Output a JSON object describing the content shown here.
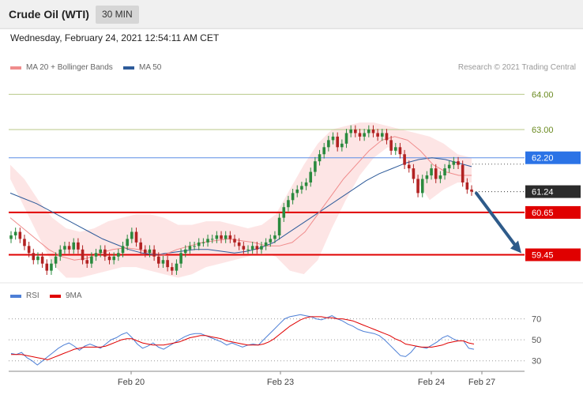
{
  "header": {
    "title": "Crude Oil (WTI)",
    "timeframe": "30 MIN"
  },
  "datetime": "Wednesday, February 24, 2021 12:54:11 AM CET",
  "legend": {
    "bb_label": "MA 20 + Bollinger Bands",
    "ma50_label": "MA 50"
  },
  "copyright": "Research © 2021 Trading Central",
  "colors": {
    "bb_fill": "#fde2e2",
    "bb_line": "#f08c8c",
    "ma50": "#2e5b9a",
    "support": "#e00000",
    "pivot": "#2b73e6",
    "target_green": "#7a9a2e",
    "up_candle": "#2a8a3e",
    "down_candle": "#b22222",
    "arrow": "#2e5b8a",
    "rsi": "#4d7fd6",
    "rsi_ma": "#e00000"
  },
  "chart_data": [
    {
      "type": "candlestick",
      "title": "Crude Oil (WTI)",
      "interval": "30 MIN",
      "y_range": [
        58.7,
        64.5
      ],
      "x_labels": [
        "Feb 20",
        "Feb 23",
        "Feb 24",
        "Feb 27"
      ],
      "levels": [
        {
          "value": 64.0,
          "label": "64.00",
          "style": "green-thin"
        },
        {
          "value": 63.0,
          "label": "63.00",
          "style": "green-thin"
        },
        {
          "value": 62.2,
          "label": "62.20",
          "style": "pivot-blue"
        },
        {
          "value": 61.24,
          "label": "61.24",
          "style": "last-price"
        },
        {
          "value": 60.65,
          "label": "60.65",
          "style": "support-red"
        },
        {
          "value": 59.45,
          "label": "59.45",
          "style": "support-red"
        }
      ],
      "closes": [
        60.0,
        60.1,
        59.9,
        59.7,
        59.5,
        59.3,
        59.4,
        59.2,
        59.0,
        59.2,
        59.4,
        59.6,
        59.7,
        59.6,
        59.8,
        59.6,
        59.3,
        59.2,
        59.4,
        59.5,
        59.6,
        59.4,
        59.3,
        59.4,
        59.5,
        59.7,
        59.9,
        60.1,
        59.8,
        59.6,
        59.5,
        59.6,
        59.4,
        59.2,
        59.3,
        59.1,
        59.0,
        59.2,
        59.5,
        59.6,
        59.7,
        59.7,
        59.8,
        59.8,
        59.9,
        59.9,
        60.0,
        59.9,
        60.0,
        59.9,
        59.8,
        59.7,
        59.6,
        59.6,
        59.7,
        59.6,
        59.7,
        59.8,
        59.9,
        60.0,
        60.5,
        60.8,
        61.0,
        61.2,
        61.3,
        61.4,
        61.5,
        61.8,
        62.1,
        62.3,
        62.5,
        62.7,
        62.8,
        62.5,
        62.6,
        62.9,
        63.0,
        62.9,
        62.8,
        62.9,
        63.0,
        62.9,
        62.8,
        62.9,
        62.7,
        62.4,
        62.5,
        62.3,
        62.0,
        61.9,
        61.6,
        61.2,
        61.6,
        61.7,
        61.9,
        61.6,
        61.7,
        61.9,
        62.0,
        62.1,
        62.0,
        61.5,
        61.3,
        61.24
      ],
      "ma50": [
        61.2,
        61.05,
        60.9,
        60.7,
        60.5,
        60.3,
        60.1,
        59.9,
        59.75,
        59.6,
        59.5,
        59.45,
        59.5,
        59.55,
        59.6,
        59.6,
        59.55,
        59.5,
        59.55,
        59.65,
        59.8,
        60.05,
        60.3,
        60.55,
        60.8,
        61.05,
        61.3,
        61.55,
        61.75,
        61.9,
        62.05,
        62.15,
        62.2,
        62.15,
        62.05,
        61.95
      ],
      "ma20": [
        60.5,
        60.2,
        59.9,
        59.6,
        59.4,
        59.3,
        59.35,
        59.5,
        59.6,
        59.65,
        59.6,
        59.5,
        59.45,
        59.6,
        59.7,
        59.8,
        59.85,
        59.9,
        59.85,
        59.8,
        59.7,
        59.7,
        59.8,
        60.1,
        60.6,
        61.1,
        61.6,
        62.0,
        62.4,
        62.7,
        62.8,
        62.7,
        62.4,
        62.0,
        61.8,
        61.7,
        61.7
      ],
      "bb_upper": [
        62.0,
        61.6,
        61.0,
        60.5,
        60.2,
        60.1,
        60.2,
        60.4,
        60.5,
        60.6,
        60.6,
        60.5,
        60.3,
        60.3,
        60.4,
        60.4,
        60.3,
        60.2,
        60.3,
        60.6,
        61.3,
        62.0,
        62.6,
        63.0,
        63.1,
        63.2,
        63.2,
        63.1,
        63.0,
        62.9,
        62.8,
        62.6,
        62.3,
        62.2
      ],
      "bb_lower": [
        61.6,
        60.8,
        60.0,
        59.2,
        58.8,
        58.8,
        58.9,
        59.0,
        59.1,
        59.1,
        59.0,
        58.9,
        58.8,
        58.9,
        59.1,
        59.2,
        59.3,
        59.4,
        59.5,
        59.4,
        59.0,
        58.9,
        59.3,
        60.2,
        61.0,
        61.7,
        62.2,
        62.5,
        62.3,
        61.6,
        61.0,
        61.3,
        61.5,
        61.5
      ],
      "projection": {
        "from": 61.24,
        "to": 59.45
      }
    },
    {
      "type": "line",
      "title": "RSI",
      "y_range": [
        23,
        84
      ],
      "y_ticks": [
        70,
        50,
        30
      ],
      "series": [
        {
          "name": "RSI",
          "values": [
            37,
            36,
            38,
            33,
            30,
            26,
            30,
            34,
            38,
            42,
            45,
            47,
            44,
            40,
            44,
            46,
            44,
            42,
            46,
            50,
            52,
            55,
            57,
            52,
            46,
            42,
            44,
            47,
            43,
            41,
            44,
            47,
            50,
            53,
            55,
            56,
            56,
            54,
            52,
            50,
            48,
            45,
            47,
            45,
            43,
            45,
            46,
            45,
            50,
            55,
            60,
            65,
            70,
            72,
            73,
            74,
            73,
            72,
            70,
            69,
            71,
            73,
            70,
            68,
            65,
            63,
            60,
            58,
            57,
            56,
            54,
            50,
            45,
            40,
            35,
            34,
            38,
            44,
            43,
            42,
            45,
            48,
            52,
            54,
            51,
            49,
            49,
            42,
            41
          ]
        },
        {
          "name": "9MA",
          "values": [
            36,
            36,
            36,
            35,
            34,
            33,
            32,
            31,
            33,
            35,
            37,
            39,
            41,
            42,
            43,
            43,
            43,
            43,
            44,
            46,
            48,
            50,
            51,
            51,
            49,
            47,
            46,
            45,
            45,
            45,
            46,
            47,
            48,
            50,
            52,
            53,
            54,
            54,
            53,
            52,
            51,
            49,
            48,
            47,
            46,
            45,
            45,
            45,
            46,
            48,
            51,
            55,
            59,
            63,
            66,
            69,
            71,
            72,
            72,
            72,
            71,
            71,
            70,
            70,
            69,
            68,
            66,
            64,
            62,
            60,
            58,
            56,
            54,
            51,
            49,
            46,
            45,
            44,
            43,
            43,
            43,
            44,
            45,
            47,
            48,
            49,
            49,
            47,
            46
          ]
        }
      ]
    }
  ]
}
